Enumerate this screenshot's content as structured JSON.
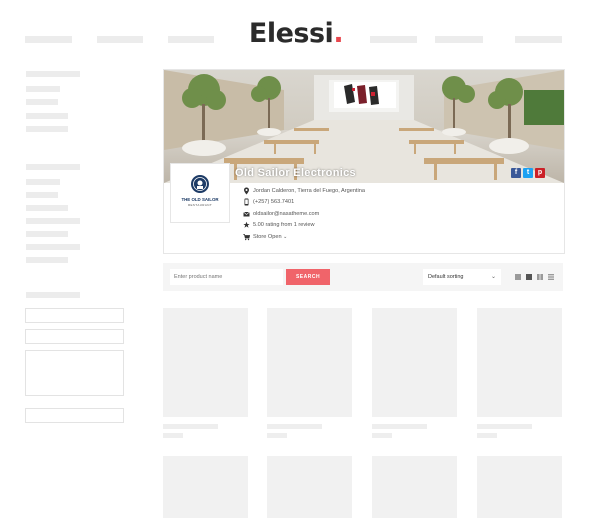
{
  "header": {
    "logo_text": "Elessi",
    "logo_dot": ".",
    "accent_color": "#e8474e"
  },
  "store": {
    "name": "Old Sailor Electronics",
    "logo_title": "THE OLD SAILOR",
    "logo_subtitle": "RESTAURANT",
    "address": "Jordan Calderon, Tierra del Fuego, Argentina",
    "phone": "(+257) 563.7401",
    "email": "oldsailor@nasatheme.com",
    "rating": "5.00 rating from 1 review",
    "store_status": "Store Open",
    "social": [
      "facebook",
      "twitter",
      "pinterest"
    ],
    "icons": [
      "map-marker-icon",
      "phone-icon",
      "envelope-icon",
      "star-icon",
      "cart-icon"
    ]
  },
  "toolbar": {
    "search_placeholder": "Enter product name",
    "search_button": "SEARCH",
    "sort_value": "Default sorting",
    "button_color": "#f0646a"
  }
}
